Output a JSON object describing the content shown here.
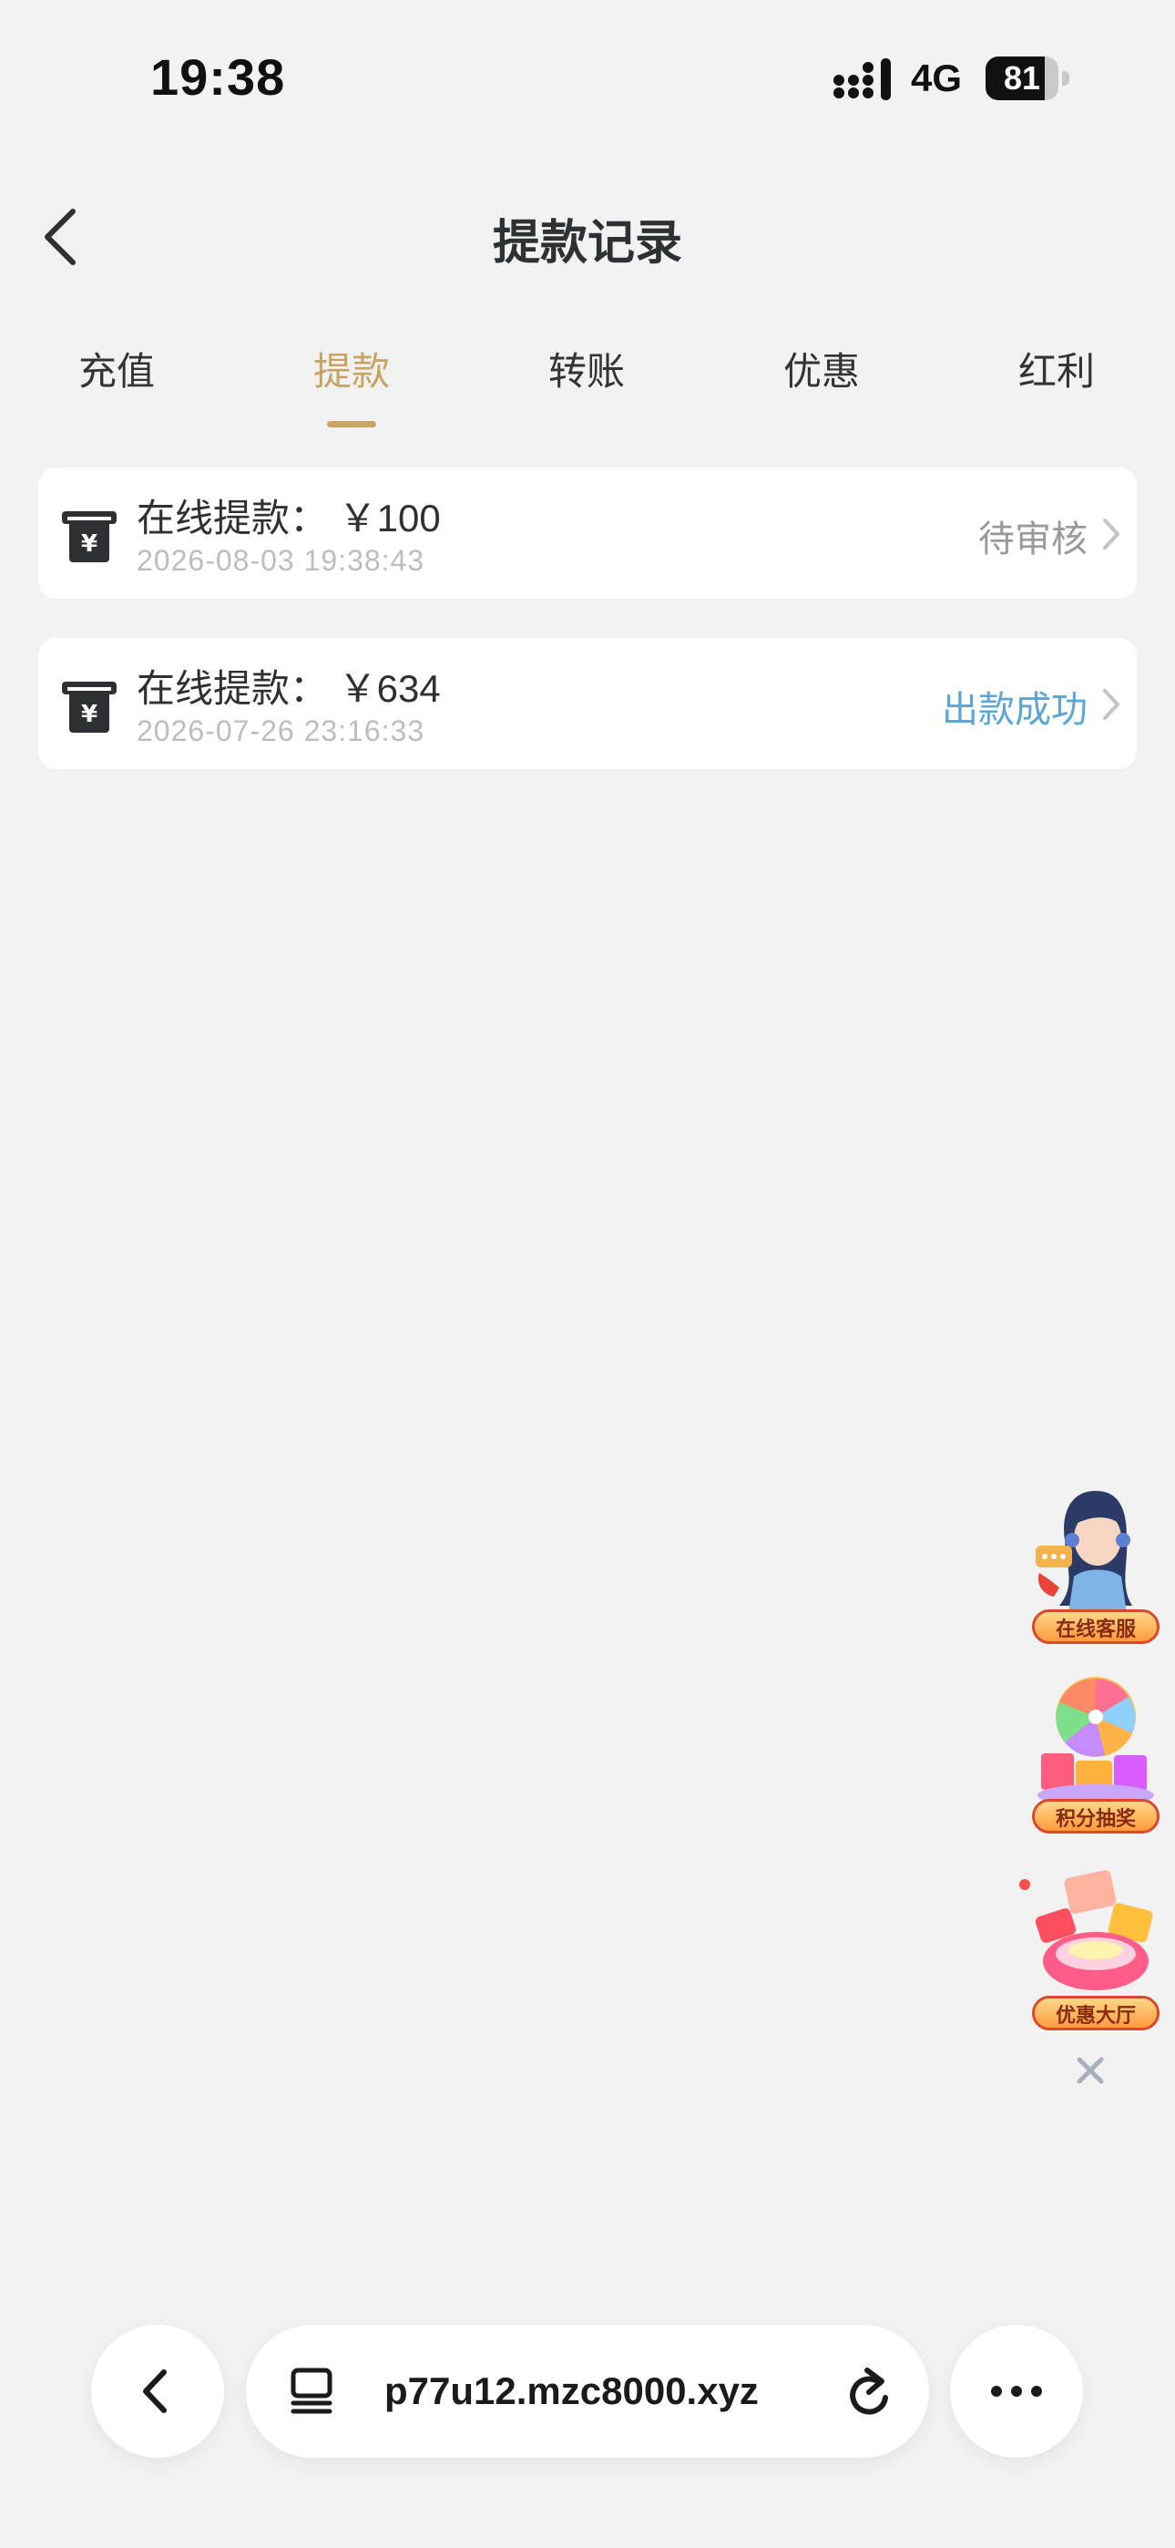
{
  "status_bar": {
    "time": "19:38",
    "network": "4G",
    "battery": "81",
    "battery_level": 0.81
  },
  "header": {
    "title": "提款记录"
  },
  "tabs": [
    {
      "label": "充值",
      "active": false
    },
    {
      "label": "提款",
      "active": true
    },
    {
      "label": "转账",
      "active": false
    },
    {
      "label": "优惠",
      "active": false
    },
    {
      "label": "红利",
      "active": false
    }
  ],
  "records": [
    {
      "title": "在线提款： ￥100",
      "timestamp": "2026-08-03 19:38:43",
      "status": "待审核",
      "status_color": "#9a9a9a"
    },
    {
      "title": "在线提款： ￥634",
      "timestamp": "2026-07-26 23:16:33",
      "status": "出款成功",
      "status_color": "#5aa6d6"
    }
  ],
  "floating": {
    "customer_service": "在线客服",
    "lottery": "积分抽奖",
    "promo_hall": "优惠大厅"
  },
  "browser": {
    "url": "p77u12.mzc8000.xyz"
  },
  "colors": {
    "accent": "#c9a35f",
    "background": "#f2f2f2",
    "pending": "#9a9a9a",
    "success": "#5aa6d6"
  }
}
